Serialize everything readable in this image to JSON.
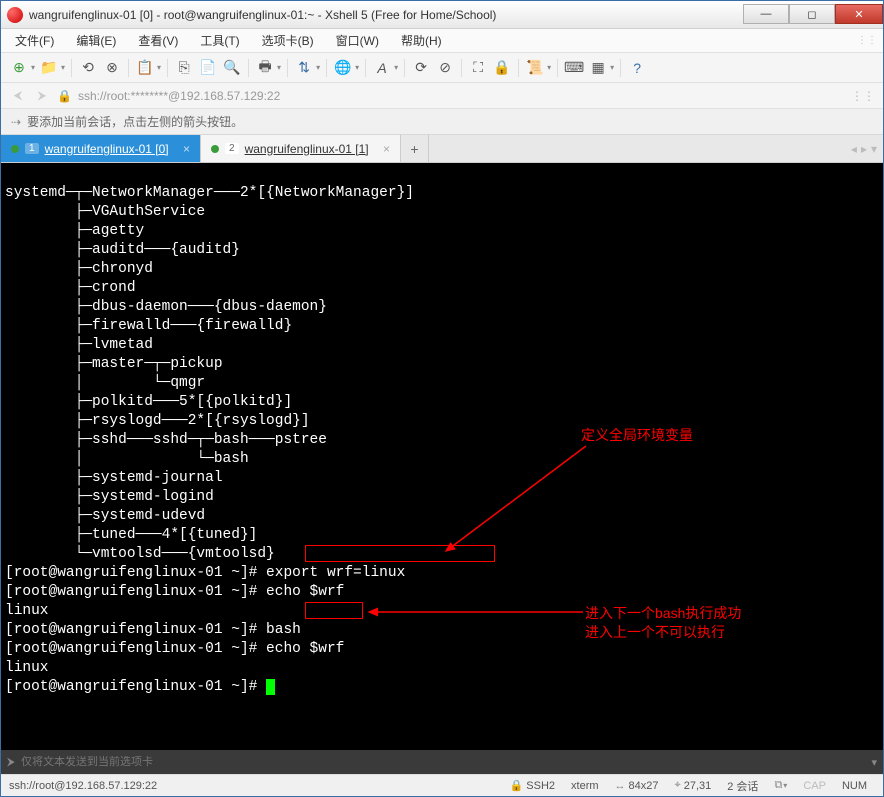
{
  "title": "wangruifenglinux-01 [0] - root@wangruifenglinux-01:~ - Xshell 5 (Free for Home/School)",
  "menu": {
    "file": "文件(F)",
    "edit": "编辑(E)",
    "view": "查看(V)",
    "tools": "工具(T)",
    "tabs": "选项卡(B)",
    "window": "窗口(W)",
    "help": "帮助(H)"
  },
  "address": "ssh://root:********@192.168.57.129:22",
  "hint": "要添加当前会话，点击左侧的箭头按钮。",
  "tabs": [
    {
      "num": "1",
      "label": "wangruifenglinux-01 [0]"
    },
    {
      "num": "2",
      "label": "wangruifenglinux-01 [1]"
    }
  ],
  "terminal": {
    "line01": "systemd─┬─NetworkManager───2*[{NetworkManager}]",
    "line02": "        ├─VGAuthService",
    "line03": "        ├─agetty",
    "line04": "        ├─auditd───{auditd}",
    "line05": "        ├─chronyd",
    "line06": "        ├─crond",
    "line07": "        ├─dbus-daemon───{dbus-daemon}",
    "line08": "        ├─firewalld───{firewalld}",
    "line09": "        ├─lvmetad",
    "line10": "        ├─master─┬─pickup",
    "line11": "        │        └─qmgr",
    "line12": "        ├─polkitd───5*[{polkitd}]",
    "line13": "        ├─rsyslogd───2*[{rsyslogd}]",
    "line14": "        ├─sshd───sshd─┬─bash───pstree",
    "line15": "        │             └─bash",
    "line16": "        ├─systemd-journal",
    "line17": "        ├─systemd-logind",
    "line18": "        ├─systemd-udevd",
    "line19": "        ├─tuned───4*[{tuned}]",
    "line20": "        └─vmtoolsd───{vmtoolsd}",
    "line21": "[root@wangruifenglinux-01 ~]# export wrf=linux",
    "line22": "[root@wangruifenglinux-01 ~]# echo $wrf",
    "line23": "linux",
    "line24": "[root@wangruifenglinux-01 ~]# bash",
    "line25": "[root@wangruifenglinux-01 ~]# echo $wrf",
    "line26": "linux",
    "line27": "[root@wangruifenglinux-01 ~]# "
  },
  "annotations": {
    "a1": "定义全局环境变量",
    "a2": "进入下一个bash执行成功",
    "a3": "进入上一个不可以执行"
  },
  "sendbar_placeholder": "仅将文本发送到当前选项卡",
  "status": {
    "url": "ssh://root@192.168.57.129:22",
    "ssh": "SSH2",
    "term": "xterm",
    "size": "84x27",
    "pos": "27,31",
    "sessions": "2 会话",
    "cap": "CAP",
    "num": "NUM"
  }
}
